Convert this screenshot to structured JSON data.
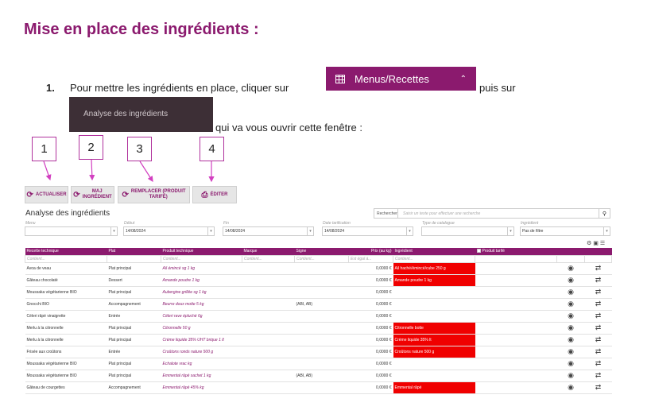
{
  "doc": {
    "title": "Mise en place des ingrédients :",
    "step_number": "1.",
    "step_text_1": "Pour mettre les ingrédients en place, cliquer sur",
    "menu_button_label": "Menus/Recettes",
    "step_text_2": "puis sur",
    "analyse_button_label": "Analyse des ingrédients",
    "step_text_3": "qui va vous ouvrir cette fenêtre :",
    "callouts": [
      "1",
      "2",
      "3",
      "4"
    ]
  },
  "toolbar": {
    "actualiser": "ACTUALISER",
    "maj_line1": "MAJ",
    "maj_line2": "INGRÉDIENT",
    "remplacer_line1": "REMPLACER (PRODUIT",
    "remplacer_line2": "TARIFÉ)",
    "editer": "ÉDITER"
  },
  "app": {
    "title": "Analyse des ingrédients",
    "search_label": "Rechercher",
    "search_placeholder": "Saisir un texte pour effectuer une recherche"
  },
  "filters": {
    "menu_label": "Menu",
    "debut_label": "Début",
    "debut_value": "14/08/2024",
    "fin_label": "Fin",
    "fin_value": "14/08/2024",
    "date_label": "Date tarification",
    "date_value": "14/08/2024",
    "type_label": "Type de catalogue",
    "ingredient_label": "Ingrédient",
    "ingredient_value": "Pas de filtre"
  },
  "table": {
    "headers": {
      "recette": "Recette technique",
      "plat": "Plat",
      "produit": "Produit technique",
      "marque": "Marque",
      "signe": "Signe",
      "prix": "Prix (au kg)",
      "ingredient": "Ingrédient",
      "tarife": "Produit tarifé"
    },
    "filter_placeholder": "Contient...",
    "filter_placeholder_prix": "Est égal à...",
    "rows": [
      {
        "recette": "Avoa de veau",
        "plat": "Plat principal",
        "produit": "Ail émincé sg 1 kg",
        "marque": "",
        "signe": "",
        "prix": "0,0000 €",
        "ingredient": "Ail haché/émincé/cube 250 g"
      },
      {
        "recette": "Gâteau chocolaté",
        "plat": "Dessert",
        "produit": "Amande poudre 1 kg",
        "marque": "",
        "signe": "",
        "prix": "0,0000 €",
        "ingredient": "Amande poudre 1 kg"
      },
      {
        "recette": "Moussaka végétarienne BIO",
        "plat": "Plat principal",
        "produit": "Aubergine grillée sg 1 kg",
        "marque": "",
        "signe": "",
        "prix": "0,0000 €",
        "ingredient": ""
      },
      {
        "recette": "Gnocchi BIO",
        "plat": "Accompagnement",
        "produit": "Beurre doux motte 5 kg",
        "marque": "",
        "signe": "(ABI, AB)",
        "prix": "0,0000 €",
        "ingredient": ""
      },
      {
        "recette": "Céleri râpé vinaigrette",
        "plat": "Entrée",
        "produit": "Céleri rave épluché 6g",
        "marque": "",
        "signe": "",
        "prix": "0,0000 €",
        "ingredient": ""
      },
      {
        "recette": "Merlu à la citronnelle",
        "plat": "Plat principal",
        "produit": "Citronnelle 50 g",
        "marque": "",
        "signe": "",
        "prix": "0,0000 €",
        "ingredient": "Citronnelle botte"
      },
      {
        "recette": "Merlu à la citronnelle",
        "plat": "Plat principal",
        "produit": "Crème liquide 35% UHT brique 1 lt",
        "marque": "",
        "signe": "",
        "prix": "0,0000 €",
        "ingredient": "Crème liquide 35% lt"
      },
      {
        "recette": "Frisée aux croûtons",
        "plat": "Entrée",
        "produit": "Croûtons ronds nature 500 g",
        "marque": "",
        "signe": "",
        "prix": "0,0000 €",
        "ingredient": "Croûtons nature 500 g"
      },
      {
        "recette": "Moussaka végétarienne BIO",
        "plat": "Plat principal",
        "produit": "Echalote vrac kg",
        "marque": "",
        "signe": "",
        "prix": "0,0000 €",
        "ingredient": ""
      },
      {
        "recette": "Moussaka végétarienne BIO",
        "plat": "Plat principal",
        "produit": "Emmental râpé sachet 1 kg",
        "marque": "",
        "signe": "(ABI, AB)",
        "prix": "0,0000 €",
        "ingredient": ""
      },
      {
        "recette": "Gâteau de courgettes",
        "plat": "Accompagnement",
        "produit": "Emmental râpé 45% kg",
        "marque": "",
        "signe": "",
        "prix": "0,0000 €",
        "ingredient": "Emmental râpé"
      }
    ]
  },
  "colors": {
    "brand": "#8b1a6e",
    "highlight": "#f00000",
    "callout_border": "#b0329d"
  }
}
